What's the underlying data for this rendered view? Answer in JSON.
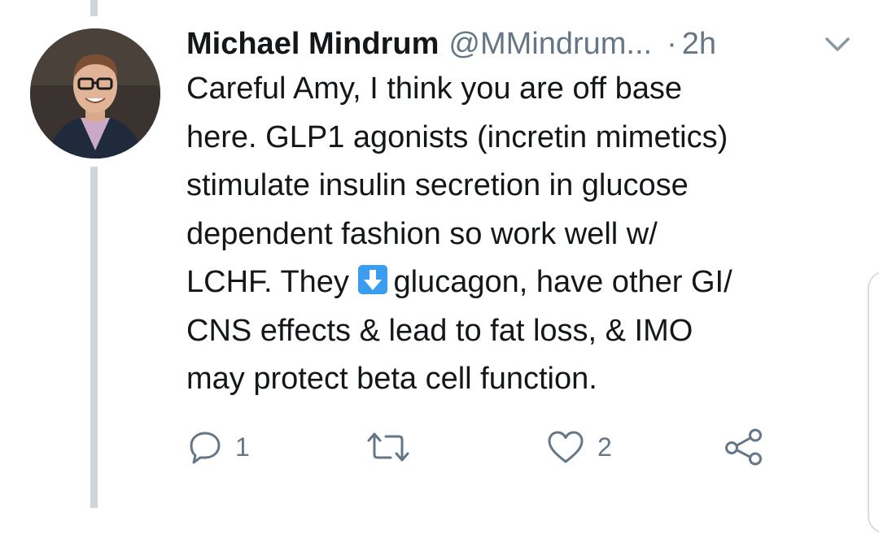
{
  "tweet": {
    "author_name": "Michael Mindrum",
    "author_handle": "@MMindrum...",
    "separator": "·",
    "time": "2h",
    "text_lines": [
      "Careful Amy, I think you are off base",
      "here. GLP1 agonists (incretin mimetics)",
      "stimulate insulin secretion in glucose",
      "dependent fashion so work well w/",
      {
        "before": "LCHF. They ",
        "emoji": "down-arrow-emoji",
        "after": "glucagon, have other GI/"
      },
      "CNS effects & lead to fat loss, & IMO",
      "may protect beta cell function."
    ]
  },
  "actions": {
    "reply": {
      "icon": "reply-icon",
      "count": "1"
    },
    "retweet": {
      "icon": "retweet-icon",
      "count": ""
    },
    "like": {
      "icon": "heart-icon",
      "count": "2"
    },
    "share": {
      "icon": "share-icon"
    }
  },
  "colors": {
    "text": "#14171a",
    "secondary": "#657786",
    "thread_line": "#cdd6dd",
    "emoji_blue": "#3b9df0"
  }
}
